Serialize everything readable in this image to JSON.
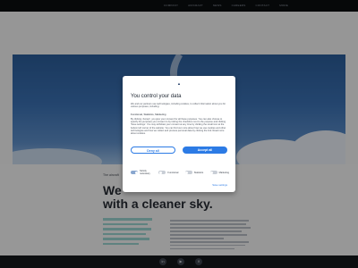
{
  "nav": {
    "items": [
      "COMPANY",
      "AIRCRAFT",
      "NEWS",
      "CAREERS",
      "CONTACT",
      "MORE"
    ]
  },
  "page": {
    "kicker": "The aircraft",
    "headline": [
      "We",
      "with a cleaner sky."
    ]
  },
  "footer": {
    "social_icons": [
      "linkedin-icon",
      "youtube-icon",
      "twitter-icon"
    ]
  },
  "dialog": {
    "title": "You control your data",
    "intro": "We and our partners use technologies, including cookies, to collect information about you for various purposes, including:",
    "purposes_label": "Functional, Statistics, Marketing",
    "details": "By clicking 'Accept', you give your consent for all these purposes. You can also choose to specify the purposes you consent to by ticking the checkbox next to the purpose and clicking 'Save settings'. You may withdraw your consent at any time by clicking the small icon at the bottom left corner of the website. You can find out more about how we use cookies and other technologies and how we collect and process personal data by clicking the link. Read more about cookies.",
    "deny_label": "Deny all",
    "accept_label": "Accept all",
    "toggles": [
      {
        "label": "Strictly necessary",
        "on": true
      },
      {
        "label": "Functional",
        "on": false
      },
      {
        "label": "Statistics",
        "on": false
      },
      {
        "label": "Marketing",
        "on": false
      }
    ],
    "save_label": "Save settings"
  }
}
